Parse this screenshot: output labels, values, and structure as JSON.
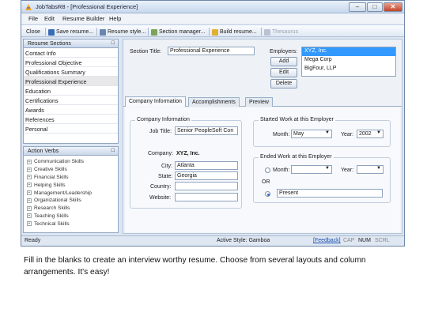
{
  "window": {
    "title": "JobTabsR8 - [Professional Experience]",
    "controls": [
      "minimize",
      "maximize",
      "close"
    ]
  },
  "menu": [
    {
      "label": "File"
    },
    {
      "label": "Edit"
    },
    {
      "label": "Resume Builder"
    },
    {
      "label": "Help"
    }
  ],
  "toolbar": {
    "close": "Close",
    "save_resume": "Save resume...",
    "resume_style": "Resume style...",
    "section_manager": "Section manager...",
    "build_resume": "Build resume...",
    "thesaurus": "Thesaurus"
  },
  "resume_sections": {
    "header": "Resume Sections",
    "items": [
      "Contact Info",
      "Professional Objective",
      "Qualifications Summary",
      "Professional Experience",
      "Education",
      "Certifications",
      "Awards",
      "References",
      "Personal"
    ],
    "selected": "Professional Experience"
  },
  "action_verbs": {
    "header": "Action Verbs",
    "items": [
      "Communication Skills",
      "Creative Skills",
      "Financial Skills",
      "Helping Skills",
      "Management/Leadership",
      "Organizational Skills",
      "Research Skills",
      "Teaching Skills",
      "Technical Skills"
    ]
  },
  "section": {
    "title_label": "Section Title:",
    "title_value": "Professional Experience",
    "employers_label": "Employers:",
    "employers": [
      "XYZ, Inc.",
      "Mega Corp",
      "BigFour, LLP"
    ],
    "selected_employer": "XYZ, Inc.",
    "add": "Add",
    "edit": "Edit",
    "delete": "Delete"
  },
  "tabs": [
    {
      "label": "Company Information",
      "active": true
    },
    {
      "label": "Accomplishments",
      "active": false
    },
    {
      "label": "Preview",
      "active": false
    }
  ],
  "company_info": {
    "group_title": "Company Information",
    "job_title_label": "Job Title:",
    "job_title_value": "Senior PeopleSoft Con",
    "company_label": "Company:",
    "company_value": "XYZ, Inc.",
    "city_label": "City:",
    "city_value": "Atlanta",
    "state_label": "State:",
    "state_value": "Georgia",
    "country_label": "Country:",
    "country_value": "",
    "website_label": "Website:",
    "website_value": ""
  },
  "started": {
    "group_title": "Started Work at this Employer",
    "month_label": "Month:",
    "month_value": "May",
    "year_label": "Year:",
    "year_value": "2002"
  },
  "ended": {
    "group_title": "Ended Work at this Employer",
    "month_label": "Month:",
    "month_value": "",
    "year_label": "Year:",
    "year_value": "",
    "or_label": "OR",
    "present_value": "Present",
    "present_selected": true
  },
  "status": {
    "left": "Ready",
    "active_style": "Active Style: Gamboa",
    "feedback": "[Feedback]",
    "cap": "CAP",
    "num": "NUM",
    "scrl": "SCRL"
  },
  "caption": "Fill in the blanks to create an interview worthy resume.  Choose from several layouts and column arrangements.  It's easy!"
}
